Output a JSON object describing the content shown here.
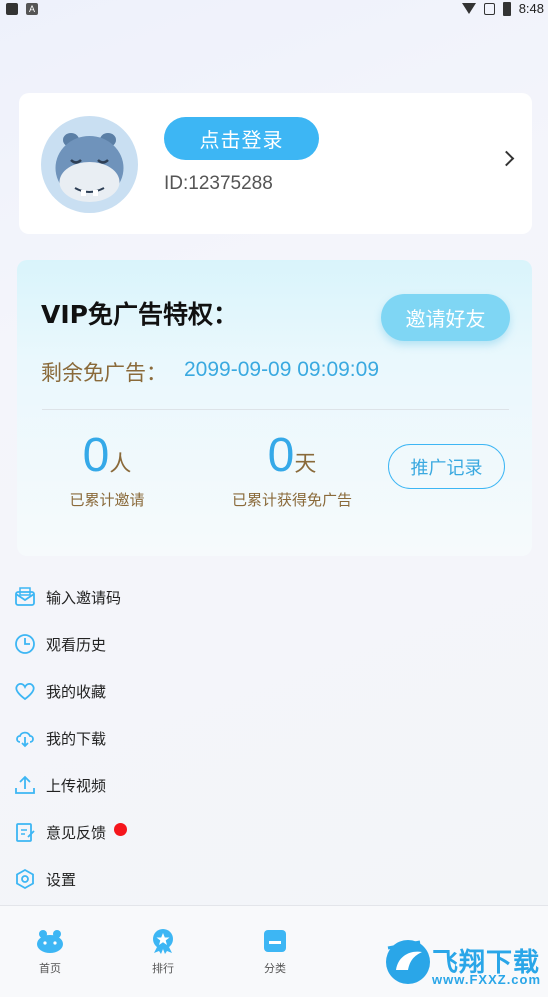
{
  "status_bar": {
    "time": "8:48",
    "badge": "A"
  },
  "profile": {
    "login_label": "点击登录",
    "user_id": "ID:12375288"
  },
  "vip": {
    "title": "VIP免广告特权：",
    "invite_label": "邀请好友",
    "remain_label": "剩余免广告：",
    "remain_value": "2099-09-09 09:09:09",
    "stats": [
      {
        "value": "0",
        "unit": "人",
        "label": "已累计邀请"
      },
      {
        "value": "0",
        "unit": "天",
        "label": "已累计获得免广告"
      }
    ],
    "promo_label": "推广记录"
  },
  "menu": [
    {
      "label": "输入邀请码",
      "icon": "mail-icon"
    },
    {
      "label": "观看历史",
      "icon": "clock-icon"
    },
    {
      "label": "我的收藏",
      "icon": "heart-icon"
    },
    {
      "label": "我的下载",
      "icon": "cloud-download-icon"
    },
    {
      "label": "上传视频",
      "icon": "upload-icon"
    },
    {
      "label": "意见反馈",
      "icon": "edit-icon",
      "badge": true
    },
    {
      "label": "设置",
      "icon": "settings-icon"
    }
  ],
  "tabs": [
    {
      "label": "首页",
      "icon": "home-icon"
    },
    {
      "label": "排行",
      "icon": "rank-icon"
    },
    {
      "label": "分类",
      "icon": "category-icon"
    }
  ],
  "watermark": {
    "text": "飞翔下载",
    "url": "www.FXXZ.com"
  },
  "colors": {
    "accent": "#3db6f4",
    "gold_text": "#8a6a3a",
    "badge_red": "#f5151c"
  }
}
